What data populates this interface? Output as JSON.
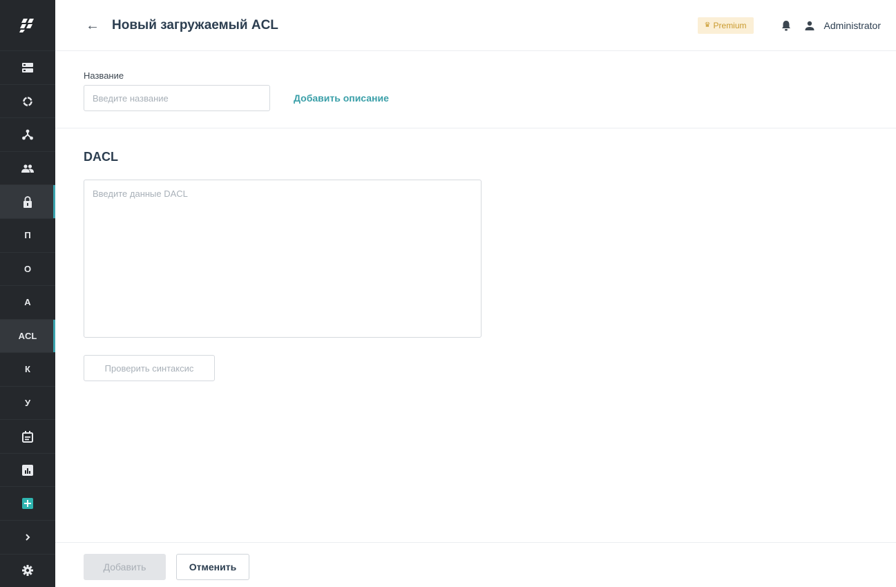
{
  "header": {
    "title": "Новый загружаемый ACL",
    "premium_label": "Premium",
    "user_name": "Administrator"
  },
  "sidebar": {
    "items": [
      {
        "type": "icon",
        "icon": "server-icon"
      },
      {
        "type": "icon",
        "icon": "circle-loading-icon"
      },
      {
        "type": "icon",
        "icon": "network-nodes-icon"
      },
      {
        "type": "icon",
        "icon": "users-icon"
      },
      {
        "type": "icon",
        "icon": "lock-icon",
        "active": true
      },
      {
        "type": "letter",
        "label": "П"
      },
      {
        "type": "letter",
        "label": "О"
      },
      {
        "type": "letter",
        "label": "А"
      },
      {
        "type": "letter",
        "label": "ACL",
        "active": true
      },
      {
        "type": "letter",
        "label": "К"
      },
      {
        "type": "letter",
        "label": "У"
      },
      {
        "type": "icon",
        "icon": "calendar-icon"
      },
      {
        "type": "icon",
        "icon": "chart-icon"
      },
      {
        "type": "icon",
        "icon": "plus-icon"
      },
      {
        "type": "icon",
        "icon": "chevron-right-icon"
      },
      {
        "type": "icon",
        "icon": "gear-icon"
      }
    ],
    "colors": {
      "background": "#25282c",
      "active_accent": "#3aa3ad",
      "plus_accent": "#2fb5b0"
    }
  },
  "form": {
    "name_label": "Название",
    "name_placeholder": "Введите название",
    "name_value": "",
    "add_description_link": "Добавить описание",
    "dacl_title": "DACL",
    "dacl_placeholder": "Введите данные DACL",
    "dacl_value": "",
    "check_syntax_button": "Проверить синтаксис"
  },
  "footer": {
    "add_button": "Добавить",
    "cancel_button": "Отменить"
  }
}
